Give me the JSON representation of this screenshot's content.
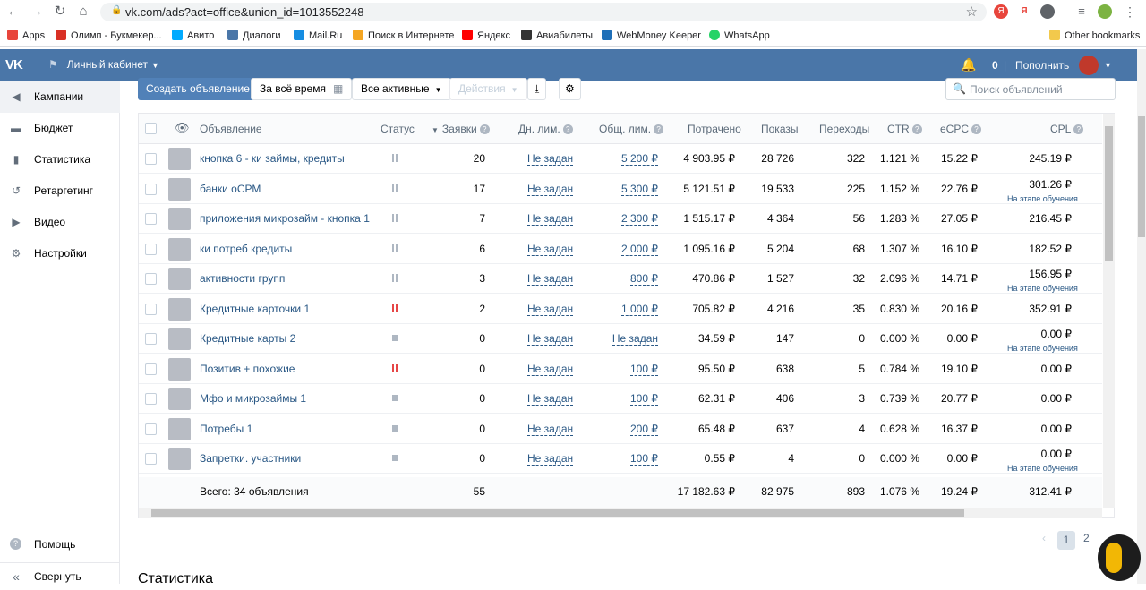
{
  "browser": {
    "url": "vk.com/ads?act=office&union_id=1013552248",
    "bookmarks": [
      {
        "label": "Apps",
        "color": "#e8453c"
      },
      {
        "label": "Олимп - Букмекер...",
        "color": "#d93025"
      },
      {
        "label": "Авито",
        "color": "#00aaff"
      },
      {
        "label": "Диалоги",
        "color": "#4a76a8"
      },
      {
        "label": "Mail.Ru",
        "color": "#168de2"
      },
      {
        "label": "Поиск в Интернете",
        "color": "#f5a623"
      },
      {
        "label": "Яндекс",
        "color": "#ff0000"
      },
      {
        "label": "Авиабилеты",
        "color": "#333333"
      },
      {
        "label": "WebMoney Keeper",
        "color": "#1e6fb8"
      },
      {
        "label": "WhatsApp",
        "color": "#25d366"
      }
    ],
    "other_bookmarks": "Other bookmarks"
  },
  "header": {
    "logo": "VK",
    "cabinet": "Личный кабинет",
    "balance": "0",
    "topup": "Пополнить"
  },
  "sidebar": {
    "items": [
      {
        "label": "Кампании",
        "icon": "megaphone-icon",
        "glyph": "◀"
      },
      {
        "label": "Бюджет",
        "icon": "wallet-icon",
        "glyph": "▬"
      },
      {
        "label": "Статистика",
        "icon": "chart-icon",
        "glyph": "▮"
      },
      {
        "label": "Ретаргетинг",
        "icon": "retarget-icon",
        "glyph": "↺"
      },
      {
        "label": "Видео",
        "icon": "video-icon",
        "glyph": "▶"
      },
      {
        "label": "Настройки",
        "icon": "gear-icon",
        "glyph": "⚙"
      }
    ],
    "help": "Помощь",
    "collapse": "Свернуть"
  },
  "toolbar": {
    "create": "Создать объявление",
    "period": "За всё время",
    "filter": "Все активные",
    "actions": "Действия",
    "search_placeholder": "Поиск объявлений"
  },
  "table": {
    "headers": {
      "ad": "Объявление",
      "status": "Статус",
      "requests": "Заявки",
      "day_limit": "Дн. лим.",
      "total_limit": "Общ. лим.",
      "spent": "Потрачено",
      "impressions": "Показы",
      "clicks": "Переходы",
      "ctr": "CTR",
      "ecpc": "eCPC",
      "cpl": "CPL"
    },
    "learning_note": "На этапе обучения",
    "rows": [
      {
        "name": "кнопка 6 - ки займы, кредиты",
        "status": "paused",
        "requests": "20",
        "day_limit": "Не задан",
        "total_limit": "5 200 ₽",
        "spent": "4 903.95 ₽",
        "impressions": "28 726",
        "clicks": "322",
        "ctr": "1.121 %",
        "ecpc": "15.22 ₽",
        "cpl": "245.19 ₽",
        "note": ""
      },
      {
        "name": "банки оСРМ",
        "status": "paused",
        "requests": "17",
        "day_limit": "Не задан",
        "total_limit": "5 300 ₽",
        "spent": "5 121.51 ₽",
        "impressions": "19 533",
        "clicks": "225",
        "ctr": "1.152 %",
        "ecpc": "22.76 ₽",
        "cpl": "301.26 ₽",
        "note": "На этапе обучения"
      },
      {
        "name": "приложения микрозайм - кнопка 1",
        "status": "paused",
        "requests": "7",
        "day_limit": "Не задан",
        "total_limit": "2 300 ₽",
        "spent": "1 515.17 ₽",
        "impressions": "4 364",
        "clicks": "56",
        "ctr": "1.283 %",
        "ecpc": "27.05 ₽",
        "cpl": "216.45 ₽",
        "note": ""
      },
      {
        "name": "ки потреб кредиты",
        "status": "paused",
        "requests": "6",
        "day_limit": "Не задан",
        "total_limit": "2 000 ₽",
        "spent": "1 095.16 ₽",
        "impressions": "5 204",
        "clicks": "68",
        "ctr": "1.307 %",
        "ecpc": "16.10 ₽",
        "cpl": "182.52 ₽",
        "note": ""
      },
      {
        "name": "активности групп",
        "status": "paused",
        "requests": "3",
        "day_limit": "Не задан",
        "total_limit": "800 ₽",
        "spent": "470.86 ₽",
        "impressions": "1 527",
        "clicks": "32",
        "ctr": "2.096 %",
        "ecpc": "14.71 ₽",
        "cpl": "156.95 ₽",
        "note": "На этапе обучения"
      },
      {
        "name": "Кредитные карточки 1",
        "status": "paused-red",
        "requests": "2",
        "day_limit": "Не задан",
        "total_limit": "1 000 ₽",
        "spent": "705.82 ₽",
        "impressions": "4 216",
        "clicks": "35",
        "ctr": "0.830 %",
        "ecpc": "20.16 ₽",
        "cpl": "352.91 ₽",
        "note": ""
      },
      {
        "name": "Кредитные карты 2",
        "status": "stopped",
        "requests": "0",
        "day_limit": "Не задан",
        "total_limit": "Не задан",
        "spent": "34.59 ₽",
        "impressions": "147",
        "clicks": "0",
        "ctr": "0.000 %",
        "ecpc": "0.00 ₽",
        "cpl": "0.00 ₽",
        "note": "На этапе обучения"
      },
      {
        "name": "Позитив + похожие",
        "status": "paused-red",
        "requests": "0",
        "day_limit": "Не задан",
        "total_limit": "100 ₽",
        "spent": "95.50 ₽",
        "impressions": "638",
        "clicks": "5",
        "ctr": "0.784 %",
        "ecpc": "19.10 ₽",
        "cpl": "0.00 ₽",
        "note": ""
      },
      {
        "name": "Мфо и микрозаймы 1",
        "status": "stopped",
        "requests": "0",
        "day_limit": "Не задан",
        "total_limit": "100 ₽",
        "spent": "62.31 ₽",
        "impressions": "406",
        "clicks": "3",
        "ctr": "0.739 %",
        "ecpc": "20.77 ₽",
        "cpl": "0.00 ₽",
        "note": ""
      },
      {
        "name": "Потребы 1",
        "status": "stopped",
        "requests": "0",
        "day_limit": "Не задан",
        "total_limit": "200 ₽",
        "spent": "65.48 ₽",
        "impressions": "637",
        "clicks": "4",
        "ctr": "0.628 %",
        "ecpc": "16.37 ₽",
        "cpl": "0.00 ₽",
        "note": ""
      },
      {
        "name": "Запретки. участники",
        "status": "stopped",
        "requests": "0",
        "day_limit": "Не задан",
        "total_limit": "100 ₽",
        "spent": "0.55 ₽",
        "impressions": "4",
        "clicks": "0",
        "ctr": "0.000 %",
        "ecpc": "0.00 ₽",
        "cpl": "0.00 ₽",
        "note": "На этапе обучения"
      }
    ],
    "totals": {
      "label": "Всего: 34 объявления",
      "requests": "55",
      "spent": "17 182.63 ₽",
      "impressions": "82 975",
      "clicks": "893",
      "ctr": "1.076 %",
      "ecpc": "19.24 ₽",
      "cpl": "312.41 ₽"
    }
  },
  "pagination": {
    "current": "1",
    "next": "2"
  },
  "section_title": "Статистика"
}
